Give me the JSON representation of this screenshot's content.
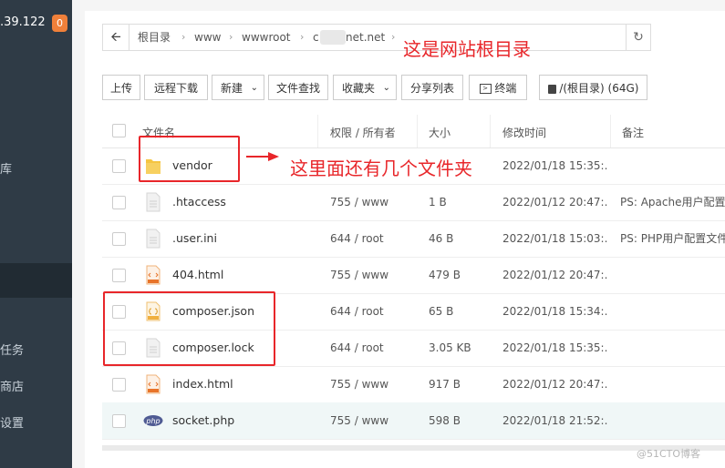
{
  "sidebar": {
    "ip": ".39.122",
    "badge": "0",
    "items": [
      {
        "label": "库"
      },
      {
        "label": ""
      },
      {
        "label": "任务"
      },
      {
        "label": "商店"
      },
      {
        "label": "设置"
      }
    ]
  },
  "breadcrumb": {
    "segments": [
      "根目录",
      "www",
      "wwwroot",
      "c",
      "net.net"
    ]
  },
  "annotations": {
    "root_note": "这是网站根目录",
    "folder_note": "这里面还有几个文件夹"
  },
  "toolbar": {
    "upload": "上传",
    "remote_download": "远程下载",
    "new": "新建",
    "file_search": "文件查找",
    "favorites": "收藏夹",
    "share_list": "分享列表",
    "terminal": "终端",
    "disk": "/(根目录) (64G)"
  },
  "table": {
    "headers": {
      "name": "文件名",
      "perm": "权限 / 所有者",
      "size": "大小",
      "mtime": "修改时间",
      "note": "备注"
    },
    "rows": [
      {
        "name": "vendor",
        "perm": "",
        "size": "",
        "mtime": "2022/01/18 15:35:...",
        "note": "",
        "icon": "folder-icon"
      },
      {
        "name": ".htaccess",
        "perm": "755 / www",
        "size": "1 B",
        "mtime": "2022/01/12 20:47:...",
        "note": "PS: Apache用户配置文",
        "icon": "file-icon"
      },
      {
        "name": ".user.ini",
        "perm": "644 / root",
        "size": "46 B",
        "mtime": "2022/01/18 15:03:...",
        "note": "PS: PHP用户配置文件",
        "icon": "file-icon"
      },
      {
        "name": "404.html",
        "perm": "755 / www",
        "size": "479 B",
        "mtime": "2022/01/12 20:47:...",
        "note": "",
        "icon": "html-file-icon"
      },
      {
        "name": "composer.json",
        "perm": "644 / root",
        "size": "65 B",
        "mtime": "2022/01/18 15:34:...",
        "note": "",
        "icon": "json-file-icon"
      },
      {
        "name": "composer.lock",
        "perm": "644 / root",
        "size": "3.05 KB",
        "mtime": "2022/01/18 15:35:...",
        "note": "",
        "icon": "file-icon"
      },
      {
        "name": "index.html",
        "perm": "755 / www",
        "size": "917 B",
        "mtime": "2022/01/12 20:47:...",
        "note": "",
        "icon": "html-file-icon"
      },
      {
        "name": "socket.php",
        "perm": "755 / www",
        "size": "598 B",
        "mtime": "2022/01/18 21:52:...",
        "note": "",
        "icon": "php-file-icon"
      }
    ]
  },
  "watermark": "@51CTO博客",
  "colors": {
    "annotation": "#e8262a",
    "sidebar": "#2f3b46",
    "badge": "#f0803a"
  }
}
